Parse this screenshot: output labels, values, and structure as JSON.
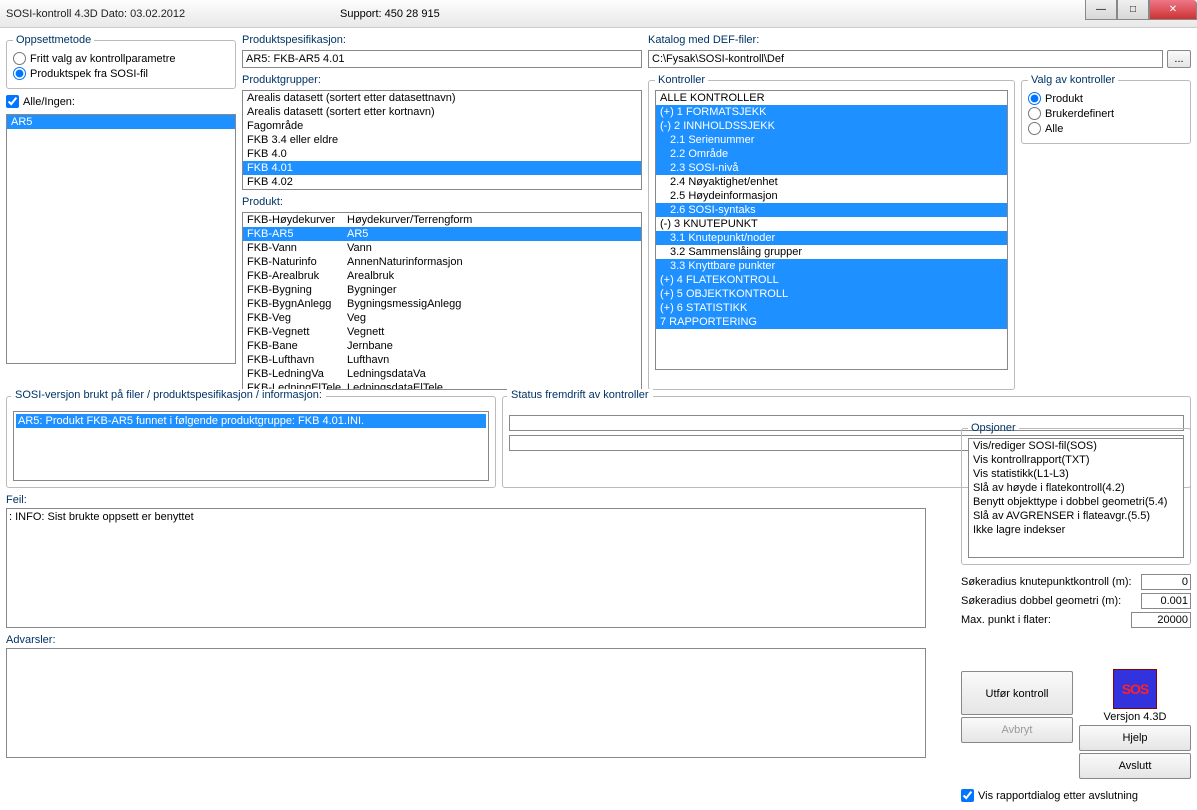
{
  "window": {
    "title": "SOSI-kontroll 4.3D   Dato: 03.02.2012",
    "support": "Support: 450 28 915"
  },
  "oppsettmetode": {
    "legend": "Oppsettmetode",
    "r1": "Fritt valg av kontrollparametre",
    "r2": "Produktspek fra SOSI-fil"
  },
  "alleingen": {
    "label": "Alle/Ingen:",
    "items": [
      "AR5"
    ]
  },
  "produktspes": {
    "label": "Produktspesifikasjon:",
    "value": "AR5: FKB-AR5 4.01"
  },
  "produktgrupper": {
    "label": "Produktgrupper:",
    "items": [
      {
        "t": "Arealis datasett (sortert etter datasettnavn)",
        "sel": false
      },
      {
        "t": "Arealis datasett (sortert etter kortnavn)",
        "sel": false
      },
      {
        "t": "Fagområde",
        "sel": false
      },
      {
        "t": "FKB 3.4 eller eldre",
        "sel": false
      },
      {
        "t": "FKB 4.0",
        "sel": false
      },
      {
        "t": "FKB 4.01",
        "sel": true
      },
      {
        "t": "FKB 4.02",
        "sel": false
      }
    ]
  },
  "produkt": {
    "label": "Produkt:",
    "items": [
      {
        "a": "FKB-Høydekurver",
        "b": "Høydekurver/Terrengform",
        "sel": false
      },
      {
        "a": "FKB-AR5",
        "b": "AR5",
        "sel": true
      },
      {
        "a": "FKB-Vann",
        "b": "Vann",
        "sel": false
      },
      {
        "a": "FKB-Naturinfo",
        "b": "AnnenNaturinformasjon",
        "sel": false
      },
      {
        "a": "FKB-Arealbruk",
        "b": "Arealbruk",
        "sel": false
      },
      {
        "a": "FKB-Bygning",
        "b": "Bygninger",
        "sel": false
      },
      {
        "a": "FKB-BygnAnlegg",
        "b": "BygningsmessigAnlegg",
        "sel": false
      },
      {
        "a": "FKB-Veg",
        "b": "Veg",
        "sel": false
      },
      {
        "a": "FKB-Vegnett",
        "b": "Vegnett",
        "sel": false
      },
      {
        "a": "FKB-Bane",
        "b": "Jernbane",
        "sel": false
      },
      {
        "a": "FKB-Lufthavn",
        "b": "Lufthavn",
        "sel": false
      },
      {
        "a": "FKB-LedningVa",
        "b": "LedningsdataVa",
        "sel": false
      },
      {
        "a": "FKB-LedningElTele",
        "b": "LedningsdataElTele",
        "sel": false
      }
    ]
  },
  "katalog": {
    "label": "Katalog med DEF-filer:",
    "value": "C:\\Fysak\\SOSI-kontroll\\Def"
  },
  "kontroller": {
    "legend": "Kontroller",
    "nodes": [
      {
        "t": "ALLE KONTROLLER",
        "ind": 0,
        "sel": false
      },
      {
        "t": "(+) 1 FORMATSJEKK",
        "ind": 0,
        "sel": true
      },
      {
        "t": "(-) 2 INNHOLDSSJEKK",
        "ind": 0,
        "sel": true
      },
      {
        "t": "2.1 Serienummer",
        "ind": 1,
        "sel": true
      },
      {
        "t": "2.2 Område",
        "ind": 1,
        "sel": true
      },
      {
        "t": "2.3 SOSI-nivå",
        "ind": 1,
        "sel": true
      },
      {
        "t": "2.4 Nøyaktighet/enhet",
        "ind": 1,
        "sel": false
      },
      {
        "t": "2.5 Høydeinformasjon",
        "ind": 1,
        "sel": false
      },
      {
        "t": "2.6 SOSI-syntaks",
        "ind": 1,
        "sel": true
      },
      {
        "t": "(-) 3 KNUTEPUNKT",
        "ind": 0,
        "sel": false
      },
      {
        "t": "3.1 Knutepunkt/noder",
        "ind": 1,
        "sel": true
      },
      {
        "t": "3.2 Sammenslåing grupper",
        "ind": 1,
        "sel": false
      },
      {
        "t": "3.3 Knyttbare punkter",
        "ind": 1,
        "sel": true
      },
      {
        "t": "(+) 4 FLATEKONTROLL",
        "ind": 0,
        "sel": true
      },
      {
        "t": "(+) 5 OBJEKTKONTROLL",
        "ind": 0,
        "sel": true
      },
      {
        "t": "(+) 6 STATISTIKK",
        "ind": 0,
        "sel": true
      },
      {
        "t": "7 RAPPORTERING",
        "ind": 0,
        "sel": true
      }
    ]
  },
  "valgkontroller": {
    "legend": "Valg av kontroller",
    "r1": "Produkt",
    "r2": "Brukerdefinert",
    "r3": "Alle"
  },
  "sosiversjon": {
    "label": "SOSI-versjon brukt på filer / produktspesifikasjon / informasjon:",
    "line": "AR5: Produkt FKB-AR5 funnet i følgende produktgruppe: FKB 4.01.INI."
  },
  "status": {
    "label": "Status fremdrift av kontroller"
  },
  "feil": {
    "label": "Feil:",
    "text": ": INFO: Sist brukte oppsett er benyttet"
  },
  "advarsler": {
    "label": "Advarsler:"
  },
  "opsjoner": {
    "legend": "Opsjoner",
    "items": [
      "Vis/rediger SOSI-fil(SOS)",
      "Vis kontrollrapport(TXT)",
      "Vis statistikk(L1-L3)",
      "Slå av høyde i flatekontroll(4.2)",
      "Benytt objekttype i dobbel geometri(5.4)",
      "Slå av AVGRENSER i flateavgr.(5.5)",
      "Ikke lagre indekser"
    ]
  },
  "nums": {
    "l1": "Søkeradius knutepunktkontroll (m):",
    "v1": "0",
    "l2": "Søkeradius dobbel geometri (m):",
    "v2": "0.001",
    "l3": "Max. punkt i flater:",
    "v3": "20000"
  },
  "buttons": {
    "utfor": "Utfør kontroll",
    "avbryt": "Avbryt",
    "versjon": "Versjon 4.3D",
    "hjelp": "Hjelp",
    "avslutt": "Avslutt"
  },
  "visrapport": "Vis rapportdialog etter avslutning",
  "browse": "..."
}
